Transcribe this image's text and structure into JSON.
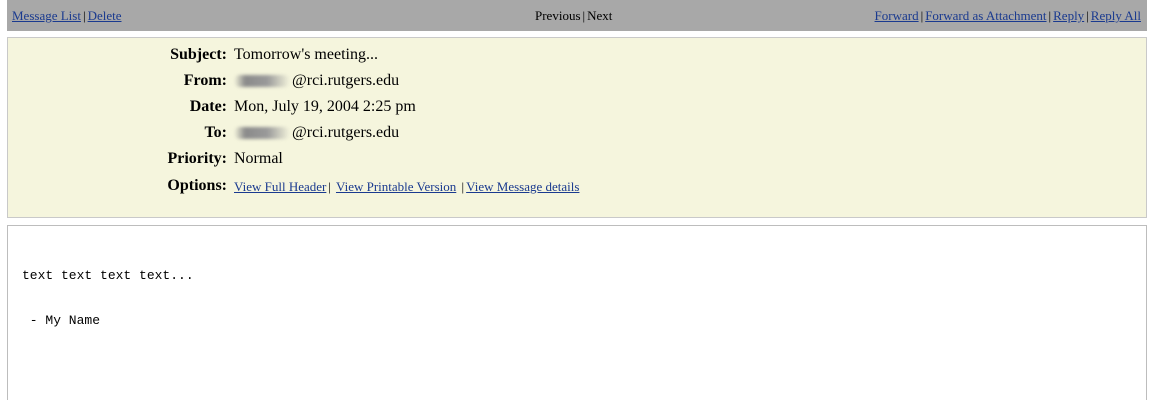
{
  "nav": {
    "left": [
      "Message List",
      "Delete"
    ],
    "center": [
      "Previous",
      "Next"
    ],
    "right": [
      "Forward",
      "Forward as Attachment",
      "Reply",
      "Reply All"
    ],
    "separator": "|"
  },
  "header": {
    "subject_label": "Subject:",
    "subject": "Tomorrow's meeting...",
    "from_label": "From:",
    "from_domain": "@rci.rutgers.edu",
    "date_label": "Date:",
    "date": "Mon, July 19, 2004 2:25 pm",
    "to_label": "To:",
    "to_domain": "@rci.rutgers.edu",
    "priority_label": "Priority:",
    "priority": "Normal",
    "options_label": "Options:",
    "options": [
      "View Full Header",
      "View Printable Version",
      "View Message details"
    ]
  },
  "body": {
    "lines": [
      "text text text text...",
      " - My Name"
    ]
  },
  "colors": {
    "nav_background": "#a8a8a8",
    "header_background": "#f5f5dd",
    "link": "#1a3a8f"
  }
}
